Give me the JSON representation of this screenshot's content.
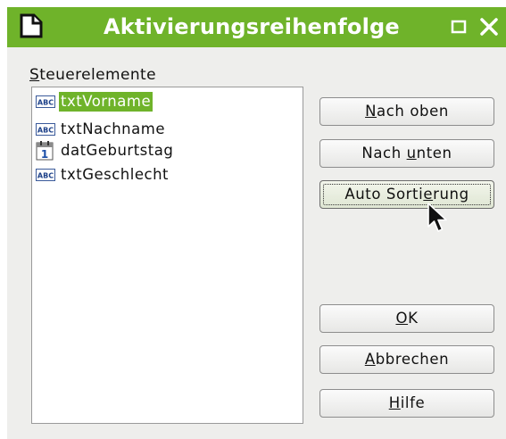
{
  "window": {
    "title": "Aktivierungsreihenfolge"
  },
  "list": {
    "label_mnemonic": "S",
    "label_rest": "teuerelemente",
    "items": [
      {
        "name": "txtVorname",
        "icon": "abc-textfield-icon",
        "selected": true
      },
      {
        "name": "txtNachname",
        "icon": "abc-textfield-icon",
        "selected": false
      },
      {
        "name": "datGeburtstag",
        "icon": "calendar-datefield-icon",
        "selected": false
      },
      {
        "name": "txtGeschlecht",
        "icon": "abc-textfield-icon",
        "selected": false
      }
    ]
  },
  "buttons": {
    "up": {
      "pre": "",
      "mn": "N",
      "post": "ach oben"
    },
    "down": {
      "pre": "Nach ",
      "mn": "u",
      "post": "nten"
    },
    "auto": {
      "pre": "Auto Sorti",
      "mn": "e",
      "post": "rung"
    },
    "ok": {
      "pre": "",
      "mn": "O",
      "post": "K"
    },
    "cancel": {
      "pre": "",
      "mn": "A",
      "post": "bbrechen"
    },
    "help": {
      "pre": "",
      "mn": "H",
      "post": "ilfe"
    }
  },
  "colors": {
    "accent": "#6fb32a",
    "titlebar_text": "#ffffff",
    "dialog_bg": "#eeeeec"
  }
}
